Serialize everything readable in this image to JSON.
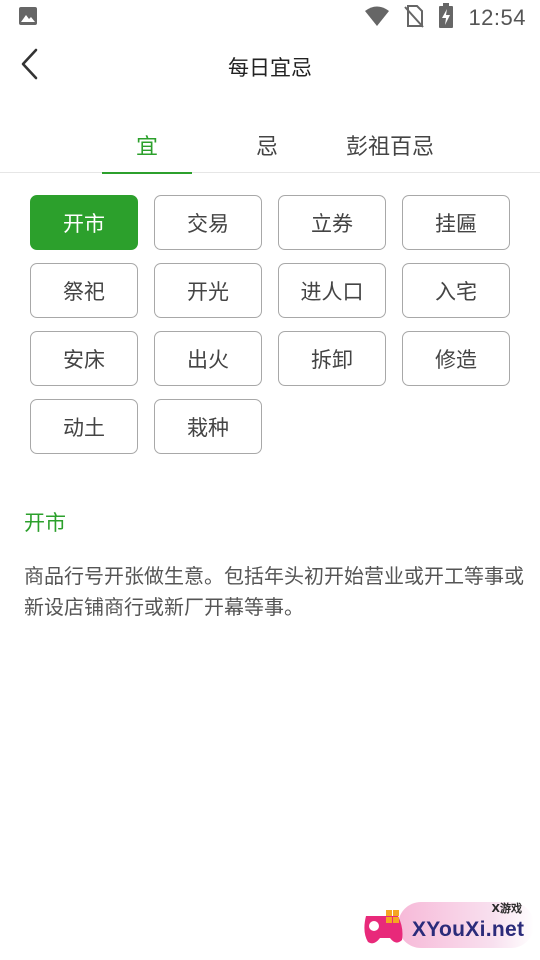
{
  "status_bar": {
    "time": "12:54",
    "icons": [
      "image-icon",
      "wifi-icon",
      "no-sim-icon",
      "battery-charging-icon"
    ]
  },
  "app_bar": {
    "title": "每日宜忌",
    "back_icon": "chevron-left-icon"
  },
  "tabs": [
    {
      "label": "宜",
      "active": true
    },
    {
      "label": "忌",
      "active": false
    },
    {
      "label": "彭祖百忌",
      "active": false
    }
  ],
  "tags": [
    {
      "label": "开市",
      "selected": true
    },
    {
      "label": "交易",
      "selected": false
    },
    {
      "label": "立券",
      "selected": false
    },
    {
      "label": "挂匾",
      "selected": false
    },
    {
      "label": "祭祀",
      "selected": false
    },
    {
      "label": "开光",
      "selected": false
    },
    {
      "label": "进人口",
      "selected": false
    },
    {
      "label": "入宅",
      "selected": false
    },
    {
      "label": "安床",
      "selected": false
    },
    {
      "label": "出火",
      "selected": false
    },
    {
      "label": "拆卸",
      "selected": false
    },
    {
      "label": "修造",
      "selected": false
    },
    {
      "label": "动土",
      "selected": false
    },
    {
      "label": "栽种",
      "selected": false
    }
  ],
  "detail": {
    "title": "开市",
    "description": "商品行号开张做生意。包括年头初开始营业或开工等事或新设店铺商行或新厂开幕等事。"
  },
  "watermark": {
    "brand": "XYouXi.net",
    "sub": "X游戏"
  },
  "colors": {
    "accent": "#2ca02c",
    "tag_border": "#a8a8a8",
    "text": "#444444"
  }
}
